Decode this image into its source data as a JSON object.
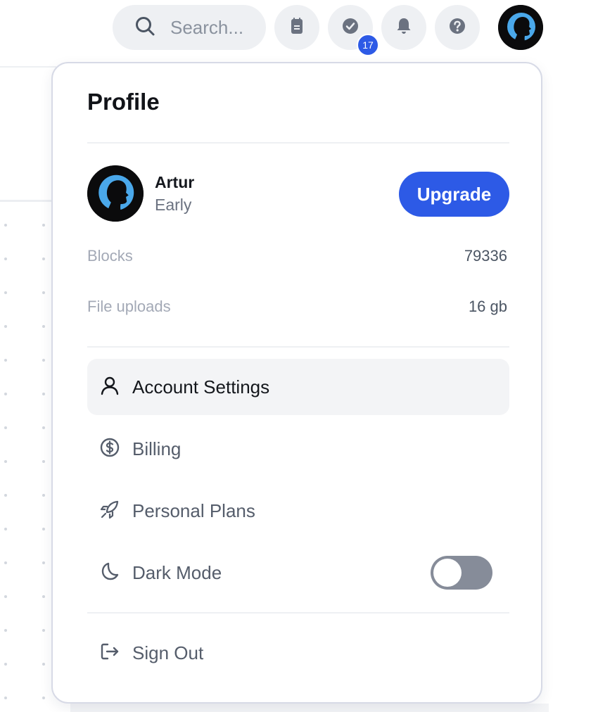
{
  "topbar": {
    "search_placeholder": "Search...",
    "tasks_badge_count": "17"
  },
  "profile_menu": {
    "title": "Profile",
    "user": {
      "name": "Artur",
      "plan": "Early"
    },
    "upgrade_label": "Upgrade",
    "stats": [
      {
        "label": "Blocks",
        "value": "79336"
      },
      {
        "label": "File uploads",
        "value": "16 gb"
      }
    ],
    "items": [
      {
        "label": "Account Settings",
        "icon": "user-icon"
      },
      {
        "label": "Billing",
        "icon": "dollar-circle-icon"
      },
      {
        "label": "Personal Plans",
        "icon": "rocket-icon"
      },
      {
        "label": "Dark Mode",
        "icon": "moon-icon"
      }
    ],
    "dark_mode_enabled": false,
    "sign_out_label": "Sign Out"
  },
  "colors": {
    "accent": "#2d5ae6",
    "toggle_off": "#868c99"
  }
}
